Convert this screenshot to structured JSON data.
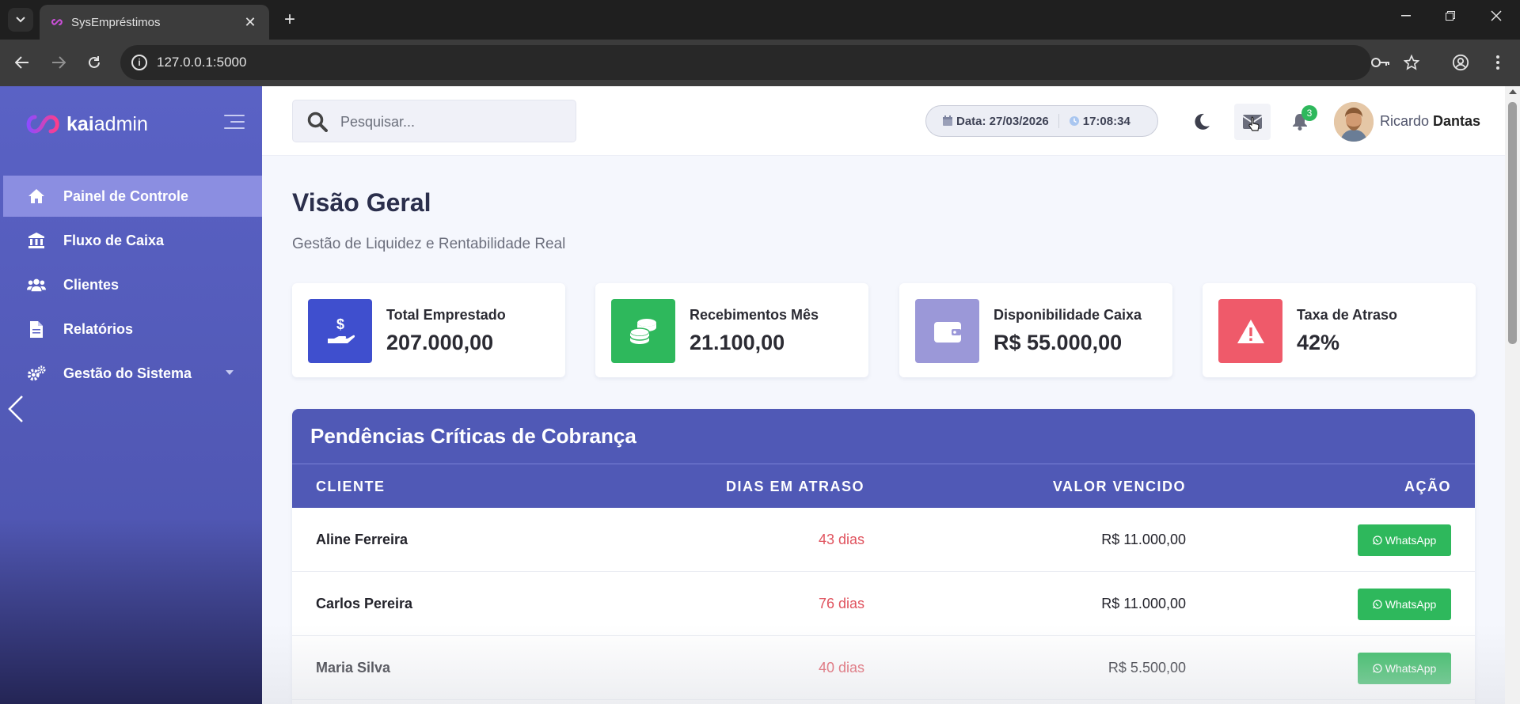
{
  "browser": {
    "tab_title": "SysEmpréstimos",
    "url": "127.0.0.1:5000"
  },
  "sidebar": {
    "logo_part1": "kai",
    "logo_part2": "admin",
    "items": [
      {
        "label": "Painel de Controle",
        "icon": "home-icon",
        "active": true
      },
      {
        "label": "Fluxo de Caixa",
        "icon": "bank-icon"
      },
      {
        "label": "Clientes",
        "icon": "users-icon"
      },
      {
        "label": "Relatórios",
        "icon": "file-icon"
      },
      {
        "label": "Gestão do Sistema",
        "icon": "cogs-icon",
        "has_submenu": true
      }
    ]
  },
  "header": {
    "search_placeholder": "Pesquisar...",
    "date": "Data: 27/03/2026",
    "time": "17:08:34",
    "notification_count": "3",
    "user_first": "Ricardo",
    "user_last": "Dantas"
  },
  "main": {
    "title": "Visão Geral",
    "subtitle": "Gestão de Liquidez e Rentabilidade Real",
    "cards": [
      {
        "label": "Total Emprestado",
        "value": "207.000,00",
        "color": "#3f4fce",
        "icon": "hand-money-icon"
      },
      {
        "label": "Recebimentos Mês",
        "value": "21.100,00",
        "color": "#2eb85c",
        "icon": "coins-icon"
      },
      {
        "label": "Disponibilidade Caixa",
        "value": "R$ 55.000,00",
        "color": "#9b98d8",
        "icon": "wallet-icon"
      },
      {
        "label": "Taxa de Atraso",
        "value": "42%",
        "color": "#ef5a6a",
        "icon": "warning-icon"
      }
    ],
    "table": {
      "title": "Pendências Críticas de Cobrança",
      "columns": [
        "CLIENTE",
        "DIAS EM ATRASO",
        "VALOR VENCIDO",
        "AÇÃO"
      ],
      "rows": [
        {
          "client": "Aline Ferreira",
          "days": "43 dias",
          "value": "R$ 11.000,00",
          "action": "WhatsApp"
        },
        {
          "client": "Carlos Pereira",
          "days": "76 dias",
          "value": "R$ 11.000,00",
          "action": "WhatsApp"
        },
        {
          "client": "Maria Silva",
          "days": "40 dias",
          "value": "R$ 5.500,00",
          "action": "WhatsApp"
        }
      ]
    }
  }
}
